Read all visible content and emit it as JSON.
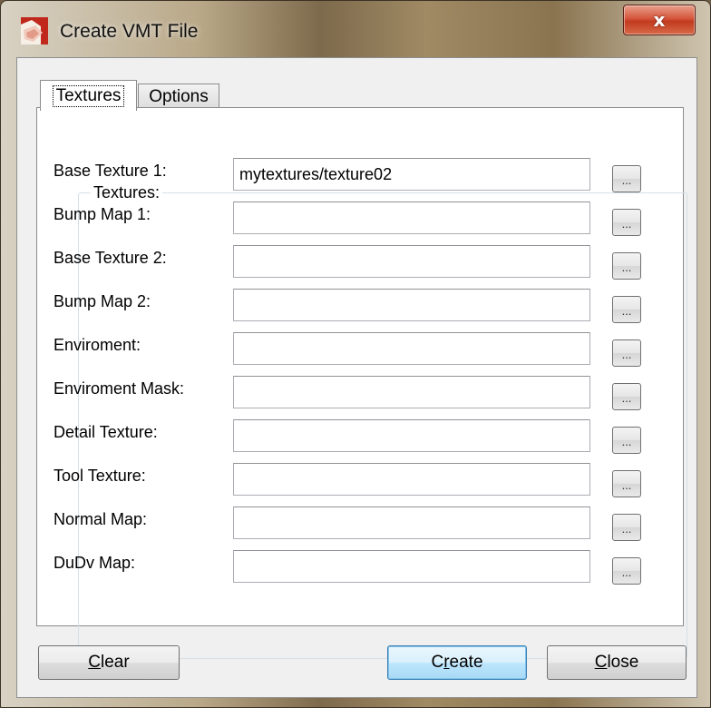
{
  "window": {
    "title": "Create VMT File",
    "close_glyph": "x"
  },
  "tabs": [
    {
      "label": "Textures",
      "selected": true
    },
    {
      "label": "Options",
      "selected": false
    }
  ],
  "group": {
    "title": "Textures:"
  },
  "fields": [
    {
      "label": "Base Texture 1:",
      "value": "mytextures/texture02",
      "browse": "..."
    },
    {
      "label": "Bump Map 1:",
      "value": "",
      "browse": "..."
    },
    {
      "label": "Base Texture 2:",
      "value": "",
      "browse": "..."
    },
    {
      "label": "Bump Map 2:",
      "value": "",
      "browse": "..."
    },
    {
      "label": "Enviroment:",
      "value": "",
      "browse": "..."
    },
    {
      "label": "Enviroment Mask:",
      "value": "",
      "browse": "..."
    },
    {
      "label": "Detail Texture:",
      "value": "",
      "browse": "..."
    },
    {
      "label": "Tool Texture:",
      "value": "",
      "browse": "..."
    },
    {
      "label": "Normal Map:",
      "value": "",
      "browse": "..."
    },
    {
      "label": "DuDv Map:",
      "value": "",
      "browse": "..."
    }
  ],
  "buttons": {
    "clear": {
      "mnemonic": "C",
      "rest": "lear"
    },
    "create": {
      "pre": "C",
      "mnemonic": "r",
      "rest": "eate"
    },
    "close": {
      "mnemonic": "C",
      "rest": "lose"
    }
  },
  "colors": {
    "default_button_border": "#3c7fb1",
    "close_button": "#c13a1f"
  }
}
